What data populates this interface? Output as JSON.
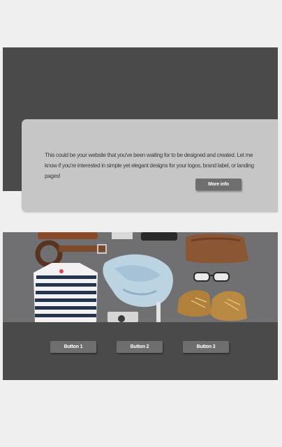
{
  "hero": {
    "info_text": "This could be your website that you've been waiting for to be designed and created.  Let me know if you're interested in simple yet elegant designs for your logos, brand label, or landing pages!",
    "more_info_label": "More info"
  },
  "photo": {
    "icon": "flat-lay-clothing-photo"
  },
  "buttons": [
    {
      "label": "Button 1"
    },
    {
      "label": "Button 2"
    },
    {
      "label": "Button 3"
    }
  ],
  "colors": {
    "background": "#efefef",
    "dark_section": "#4a4a4a",
    "card": "#c6c6c6",
    "button": "#6e6e6e",
    "button_text": "#ffffff"
  }
}
